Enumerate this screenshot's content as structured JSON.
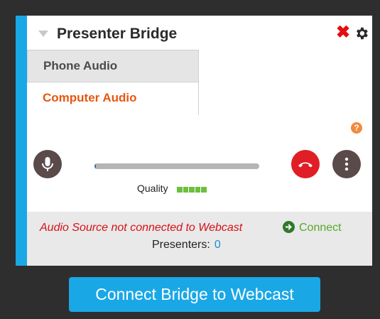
{
  "header": {
    "title": "Presenter Bridge"
  },
  "tabs": [
    {
      "label": "Phone Audio"
    },
    {
      "label": "Computer Audio"
    }
  ],
  "controls": {
    "help_glyph": "?",
    "progress_fraction": 0.01,
    "quality_label": "Quality",
    "quality_level": 5
  },
  "status": {
    "warning": "Audio Source not connected to Webcast",
    "connect_label": "Connect",
    "presenters_label": "Presenters:",
    "presenters_count": "0"
  },
  "cta": {
    "label": "Connect Bridge to Webcast"
  },
  "icons": {
    "collapse": "chevron-down-icon",
    "close": "close-icon",
    "settings": "gear-icon",
    "help": "help-icon",
    "mic": "microphone-icon",
    "hangup": "hang-up-icon",
    "more": "more-vertical-icon",
    "connect": "arrow-right-circle-icon"
  },
  "colors": {
    "accent": "#1aa7e6",
    "active_tab": "#e8560f",
    "danger": "#e01e25",
    "warning_text": "#d51116",
    "success": "#5aa62e",
    "link": "#1a8fd6"
  }
}
